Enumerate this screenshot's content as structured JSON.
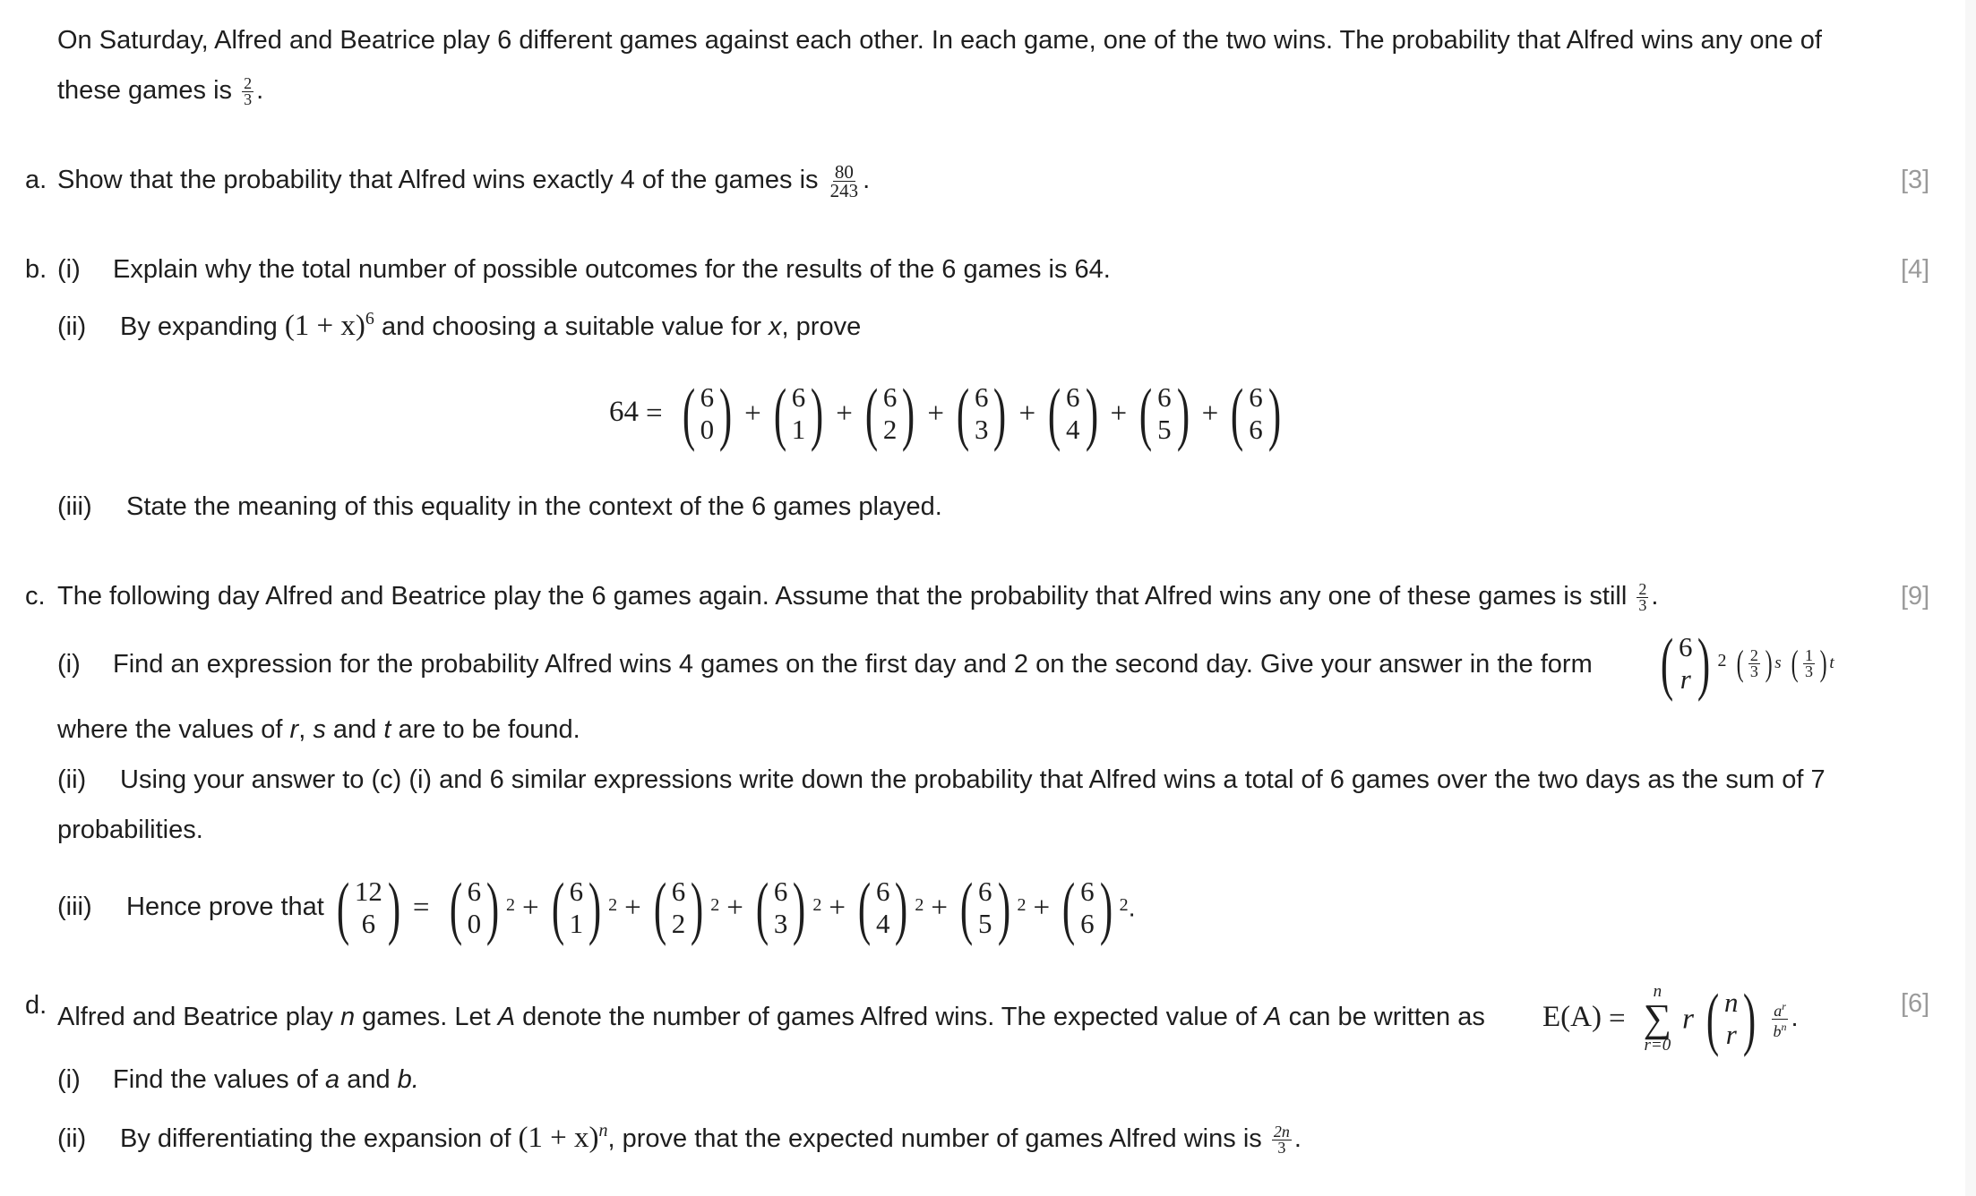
{
  "intro": {
    "line1": "On Saturday, Alfred and Beatrice play 6 different games against each other. In each game, one of the two wins. The probability that Alfred wins any one of",
    "line2_prefix": "these games is",
    "prob_num": "2",
    "prob_den": "3",
    "end": "."
  },
  "part_a": {
    "label": "a.",
    "text": "Show that the probability that Alfred wins exactly 4 of the games is",
    "frac_num": "80",
    "frac_den": "243",
    "end": ".",
    "marks": "[3]"
  },
  "part_b": {
    "label": "b.",
    "marks": "[4]",
    "i": {
      "label": "(i)",
      "text": "Explain why the total number of possible outcomes for the results of the 6 games is 64."
    },
    "ii": {
      "label": "(ii)",
      "prefix": "By expanding",
      "expr": "(1 + x)",
      "exp": "6",
      "suffix_a": "and choosing a suitable value for",
      "var": "x",
      "suffix_b": ", prove"
    },
    "equation": {
      "lhs": "64",
      "eq": "=",
      "plus": "+",
      "terms": [
        {
          "n": "6",
          "k": "0"
        },
        {
          "n": "6",
          "k": "1"
        },
        {
          "n": "6",
          "k": "2"
        },
        {
          "n": "6",
          "k": "3"
        },
        {
          "n": "6",
          "k": "4"
        },
        {
          "n": "6",
          "k": "5"
        },
        {
          "n": "6",
          "k": "6"
        }
      ]
    },
    "iii": {
      "label": "(iii)",
      "text": "State the meaning of this equality in the context of the 6 games played."
    }
  },
  "part_c": {
    "label": "c.",
    "text": "The following day Alfred and Beatrice play the 6 games again. Assume that the probability that Alfred wins any one of these games is still",
    "frac_num": "2",
    "frac_den": "3",
    "end": ".",
    "marks": "[9]",
    "i": {
      "label": "(i)",
      "text": "Find an expression for the probability Alfred wins 4 games on the first day and 2 on the second day. Give your answer in the form",
      "form": {
        "binom_n": "6",
        "binom_k": "r",
        "binom_exp": "2",
        "p_num": "2",
        "p_den": "3",
        "p_exp": "s",
        "q_num": "1",
        "q_den": "3",
        "q_exp": "t"
      },
      "cont_prefix": "where the values of",
      "cont_r": "r",
      "cont_comma": ",",
      "cont_s": "s",
      "cont_and": "and",
      "cont_t": "t",
      "cont_suffix": "are to be found."
    },
    "ii": {
      "label": "(ii)",
      "text": "Using your answer to (c) (i) and 6 similar expressions write down the probability that Alfred wins a total of 6 games over the two days as the sum of 7",
      "cont": "probabilities."
    },
    "iii": {
      "label": "(iii)",
      "text": "Hence prove that",
      "lhs_n": "12",
      "lhs_k": "6",
      "eq": "=",
      "plus": "+",
      "exp": "2",
      "terms": [
        {
          "n": "6",
          "k": "0"
        },
        {
          "n": "6",
          "k": "1"
        },
        {
          "n": "6",
          "k": "2"
        },
        {
          "n": "6",
          "k": "3"
        },
        {
          "n": "6",
          "k": "4"
        },
        {
          "n": "6",
          "k": "5"
        },
        {
          "n": "6",
          "k": "6"
        }
      ],
      "end": "."
    }
  },
  "part_d": {
    "label": "d.",
    "marks": "[6]",
    "text_a": "Alfred and Beatrice play",
    "var_n": "n",
    "text_b": "games. Let",
    "var_A": "A",
    "text_c": "denote the number of games Alfred wins. The expected value of",
    "var_A2": "A",
    "text_d": "can be written as",
    "formula": {
      "lhs": "E(A)",
      "eq": "=",
      "sum_upper": "n",
      "sum_lower": "r=0",
      "sum_symbol": "∑",
      "r": "r",
      "binom_n": "n",
      "binom_k": "r",
      "num": "a",
      "num_exp": "r",
      "den": "b",
      "den_exp": "n",
      "end": "."
    },
    "i": {
      "label": "(i)",
      "prefix": "Find the values of",
      "a": "a",
      "and": "and",
      "b": "b",
      "end": "."
    },
    "ii": {
      "label": "(ii)",
      "prefix": "By differentiating the expansion of",
      "expr": "(1 + x)",
      "exp": "n",
      "suffix": ", prove that the expected number of games Alfred wins is",
      "frac_num": "2n",
      "frac_den": "3",
      "end": "."
    }
  }
}
